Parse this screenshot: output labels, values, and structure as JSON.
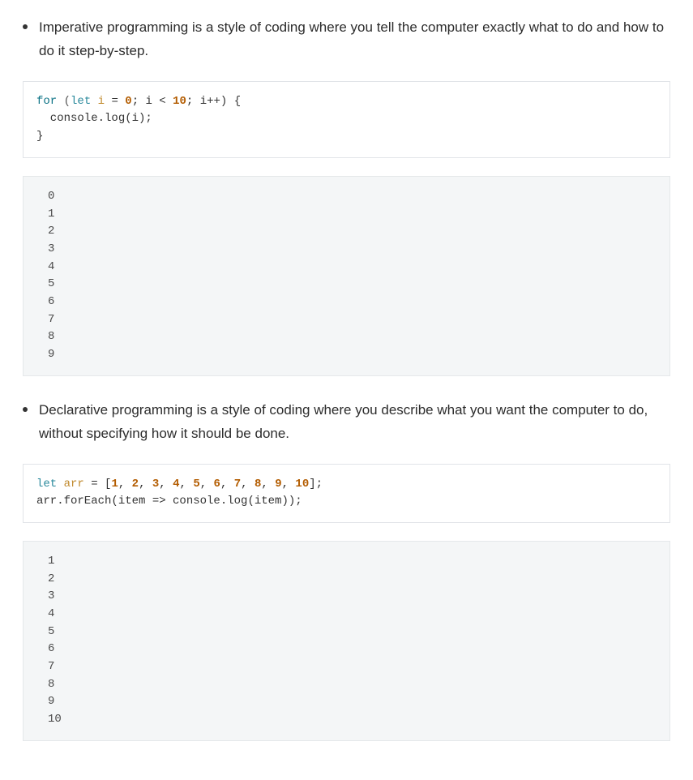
{
  "items": [
    {
      "text": "Imperative programming is a style of coding where you tell the computer exactly what to do and how to do it step-by-step.",
      "code": {
        "tokens": [
          {
            "t": "for",
            "c": "kw-for"
          },
          {
            "t": " ",
            "c": "plain"
          },
          {
            "t": "(",
            "c": "paren"
          },
          {
            "t": "let",
            "c": "kw-let"
          },
          {
            "t": " ",
            "c": "plain"
          },
          {
            "t": "i",
            "c": "var"
          },
          {
            "t": " = ",
            "c": "plain"
          },
          {
            "t": "0",
            "c": "num"
          },
          {
            "t": "; i < ",
            "c": "plain"
          },
          {
            "t": "10",
            "c": "num"
          },
          {
            "t": "; i++) {\n  console.log(i);\n}",
            "c": "plain"
          }
        ]
      },
      "output": "0\n1\n2\n3\n4\n5\n6\n7\n8\n9"
    },
    {
      "text": "Declarative programming is a style of coding where you describe what you want the computer to do, without specifying how it should be done.",
      "code": {
        "tokens": [
          {
            "t": "let",
            "c": "kw-let"
          },
          {
            "t": " ",
            "c": "plain"
          },
          {
            "t": "arr",
            "c": "var"
          },
          {
            "t": " = [",
            "c": "plain"
          },
          {
            "t": "1",
            "c": "num"
          },
          {
            "t": ", ",
            "c": "plain"
          },
          {
            "t": "2",
            "c": "num"
          },
          {
            "t": ", ",
            "c": "plain"
          },
          {
            "t": "3",
            "c": "num"
          },
          {
            "t": ", ",
            "c": "plain"
          },
          {
            "t": "4",
            "c": "num"
          },
          {
            "t": ", ",
            "c": "plain"
          },
          {
            "t": "5",
            "c": "num"
          },
          {
            "t": ", ",
            "c": "plain"
          },
          {
            "t": "6",
            "c": "num"
          },
          {
            "t": ", ",
            "c": "plain"
          },
          {
            "t": "7",
            "c": "num"
          },
          {
            "t": ", ",
            "c": "plain"
          },
          {
            "t": "8",
            "c": "num"
          },
          {
            "t": ", ",
            "c": "plain"
          },
          {
            "t": "9",
            "c": "num"
          },
          {
            "t": ", ",
            "c": "plain"
          },
          {
            "t": "10",
            "c": "num"
          },
          {
            "t": "];\narr.forEach(item => console.log(item));",
            "c": "plain"
          }
        ]
      },
      "output": "1\n2\n3\n4\n5\n6\n7\n8\n9\n10"
    }
  ]
}
